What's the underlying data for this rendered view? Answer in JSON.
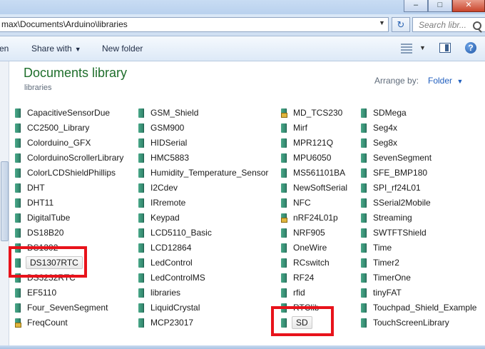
{
  "window": {
    "minimize": "–",
    "maximize": "□",
    "close": "✕"
  },
  "address": {
    "path": "max\\Documents\\Arduino\\libraries",
    "search_placeholder": "Search libr..."
  },
  "toolbar": {
    "open": "en",
    "share_with": "Share with",
    "new_folder": "New folder",
    "help": "?"
  },
  "library": {
    "title": "Documents library",
    "subtitle": "libraries",
    "arrange_label": "Arrange by:",
    "arrange_value": "Folder"
  },
  "columns": [
    [
      {
        "name": "CapacitiveSensorDue"
      },
      {
        "name": "CC2500_Library"
      },
      {
        "name": "Colorduino_GFX"
      },
      {
        "name": "ColorduinoScrollerLibrary"
      },
      {
        "name": "ColorLCDShieldPhillips"
      },
      {
        "name": "DHT"
      },
      {
        "name": "DHT11"
      },
      {
        "name": "DigitalTube"
      },
      {
        "name": "DS18B20"
      },
      {
        "name": "DS1302"
      },
      {
        "name": "DS1307RTC",
        "selected": true
      },
      {
        "name": "DS3232RTC"
      },
      {
        "name": "EF5110"
      },
      {
        "name": "Four_SevenSegment"
      },
      {
        "name": "FreqCount",
        "locked": true
      }
    ],
    [
      {
        "name": "GSM_Shield"
      },
      {
        "name": "GSM900"
      },
      {
        "name": "HIDSerial"
      },
      {
        "name": "HMC5883"
      },
      {
        "name": "Humidity_Temperature_Sensor"
      },
      {
        "name": "I2Cdev"
      },
      {
        "name": "IRremote"
      },
      {
        "name": "Keypad"
      },
      {
        "name": "LCD5110_Basic"
      },
      {
        "name": "LCD12864"
      },
      {
        "name": "LedControl"
      },
      {
        "name": "LedControlMS"
      },
      {
        "name": "libraries"
      },
      {
        "name": "LiquidCrystal"
      },
      {
        "name": "MCP23017"
      }
    ],
    [
      {
        "name": "MD_TCS230",
        "locked": true
      },
      {
        "name": "Mirf"
      },
      {
        "name": "MPR121Q"
      },
      {
        "name": "MPU6050"
      },
      {
        "name": "MS561101BA"
      },
      {
        "name": "NewSoftSerial"
      },
      {
        "name": "NFC"
      },
      {
        "name": "nRF24L01p",
        "locked": true
      },
      {
        "name": "NRF905"
      },
      {
        "name": "OneWire"
      },
      {
        "name": "RCswitch"
      },
      {
        "name": "RF24"
      },
      {
        "name": "rfid"
      },
      {
        "name": "RTClib"
      },
      {
        "name": "SD",
        "selected": true
      }
    ],
    [
      {
        "name": "SDMega"
      },
      {
        "name": "Seg4x"
      },
      {
        "name": "Seg8x"
      },
      {
        "name": "SevenSegment"
      },
      {
        "name": "SFE_BMP180"
      },
      {
        "name": "SPI_rf24L01"
      },
      {
        "name": "SSerial2Mobile"
      },
      {
        "name": "Streaming"
      },
      {
        "name": "SWTFTShield"
      },
      {
        "name": "Time"
      },
      {
        "name": "Timer2"
      },
      {
        "name": "TimerOne"
      },
      {
        "name": "tinyFAT"
      },
      {
        "name": "Touchpad_Shield_Example"
      },
      {
        "name": "TouchScreenLibrary"
      }
    ]
  ],
  "colors": {
    "library_title": "#1e6e2b",
    "link": "#1f5ebe",
    "highlight": "#e8131b",
    "folder": "#3a9479"
  }
}
